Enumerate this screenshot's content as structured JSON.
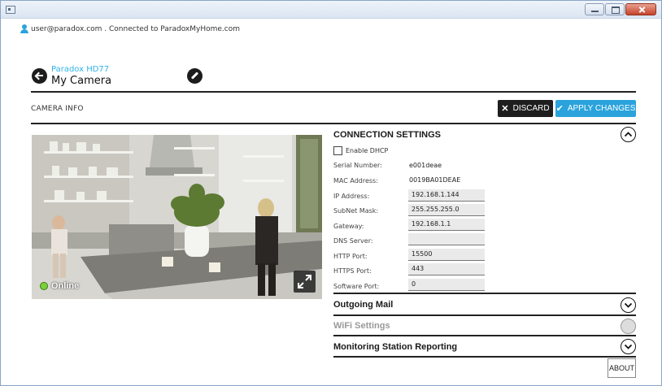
{
  "user": {
    "email": "user@paradox.com",
    "connection_text": " . Connected to ParadoxMyHome.com"
  },
  "device": {
    "model": "Paradox HD77",
    "name": "My Camera"
  },
  "section_title": "CAMERA INFO",
  "buttons": {
    "discard": "DISCARD",
    "apply": "APPLY CHANGES",
    "about": "ABOUT"
  },
  "camera": {
    "status": "Online"
  },
  "connection": {
    "title": "CONNECTION SETTINGS",
    "dhcp_label": "Enable DHCP",
    "fields": [
      {
        "label": "Serial Number:",
        "value": "e001deae"
      },
      {
        "label": "MAC Address:",
        "value": "0019BA01DEAE"
      },
      {
        "label": "IP Address:",
        "value": "192.168.1.144"
      },
      {
        "label": "SubNet Mask:",
        "value": "255.255.255.0"
      },
      {
        "label": "Gateway:",
        "value": "192.168.1.1"
      },
      {
        "label": "DNS Server:",
        "value": ""
      },
      {
        "label": "HTTP Port:",
        "value": "15500"
      },
      {
        "label": "HTTPS Port:",
        "value": "443"
      },
      {
        "label": "Software Port:",
        "value": "0"
      }
    ]
  },
  "sections": [
    {
      "title": "Outgoing Mail"
    },
    {
      "title": "WiFi Settings"
    },
    {
      "title": "Monitoring Station Reporting"
    }
  ],
  "colors": {
    "accent": "#2aa3dc",
    "model_text": "#2fb5e6",
    "online": "#7ad13a"
  }
}
